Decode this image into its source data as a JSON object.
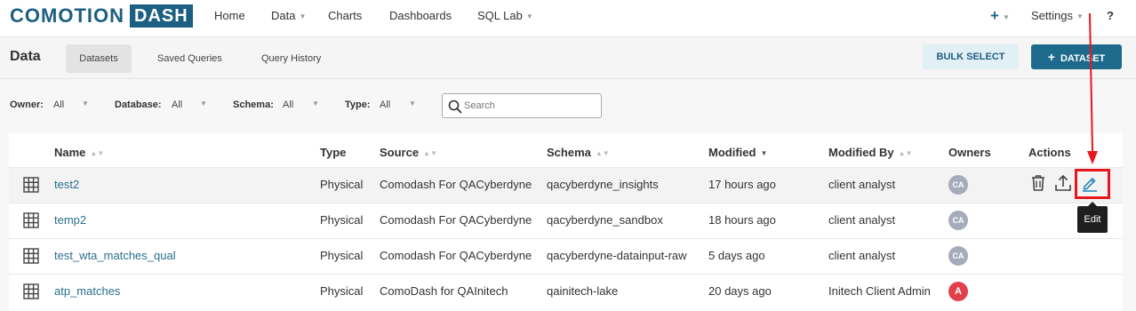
{
  "brand": {
    "name_part1": "COMOTION",
    "name_part2": "DASH"
  },
  "nav": {
    "items": [
      {
        "label": "Home",
        "has_caret": false
      },
      {
        "label": "Data",
        "has_caret": true
      },
      {
        "label": "Charts",
        "has_caret": false
      },
      {
        "label": "Dashboards",
        "has_caret": false
      },
      {
        "label": "SQL Lab",
        "has_caret": true
      }
    ],
    "right": {
      "add_icon": "plus-icon",
      "settings_label": "Settings",
      "help_label": "?"
    }
  },
  "subheader": {
    "title": "Data",
    "tabs": [
      {
        "label": "Datasets",
        "active": true
      },
      {
        "label": "Saved Queries",
        "active": false
      },
      {
        "label": "Query History",
        "active": false
      }
    ],
    "bulk_select_label": "BULK SELECT",
    "add_dataset_label": "DATASET"
  },
  "filters": {
    "items": [
      {
        "label": "Owner:",
        "value": "All"
      },
      {
        "label": "Database:",
        "value": "All"
      },
      {
        "label": "Schema:",
        "value": "All"
      },
      {
        "label": "Type:",
        "value": "All"
      }
    ],
    "search_placeholder": "Search"
  },
  "table": {
    "columns": [
      "Name",
      "Type",
      "Source",
      "Schema",
      "Modified",
      "Modified By",
      "Owners",
      "Actions"
    ],
    "sorted_column": "Modified",
    "rows": [
      {
        "name": "test2",
        "type": "Physical",
        "source": "Comodash For QACyberdyne",
        "schema": "qacyberdyne_insights",
        "modified": "17 hours ago",
        "modified_by": "client analyst",
        "owner_initials": "CA"
      },
      {
        "name": "temp2",
        "type": "Physical",
        "source": "Comodash For QACyberdyne",
        "schema": "qacyberdyne_sandbox",
        "modified": "18 hours ago",
        "modified_by": "client analyst",
        "owner_initials": "CA"
      },
      {
        "name": "test_wta_matches_qual",
        "type": "Physical",
        "source": "Comodash For QACyberdyne",
        "schema": "qacyberdyne-datainput-raw",
        "modified": "5 days ago",
        "modified_by": "client analyst",
        "owner_initials": "CA"
      },
      {
        "name": "atp_matches",
        "type": "Physical",
        "source": "ComoDash for QAInitech",
        "schema": "qainitech-lake",
        "modified": "20 days ago",
        "modified_by": "Initech Client Admin",
        "owner_initials": "A"
      }
    ],
    "row_actions": [
      "trash-icon",
      "upload-icon",
      "pencil-icon"
    ]
  },
  "tooltip": {
    "label": "Edit"
  },
  "colors": {
    "brand": "#1d5f82",
    "primary_button": "#1d6a8c",
    "link": "#2a6f8e",
    "annotation": "#e8171d",
    "avatar_default": "#a6acbc",
    "avatar_alt": "#e0414a"
  }
}
